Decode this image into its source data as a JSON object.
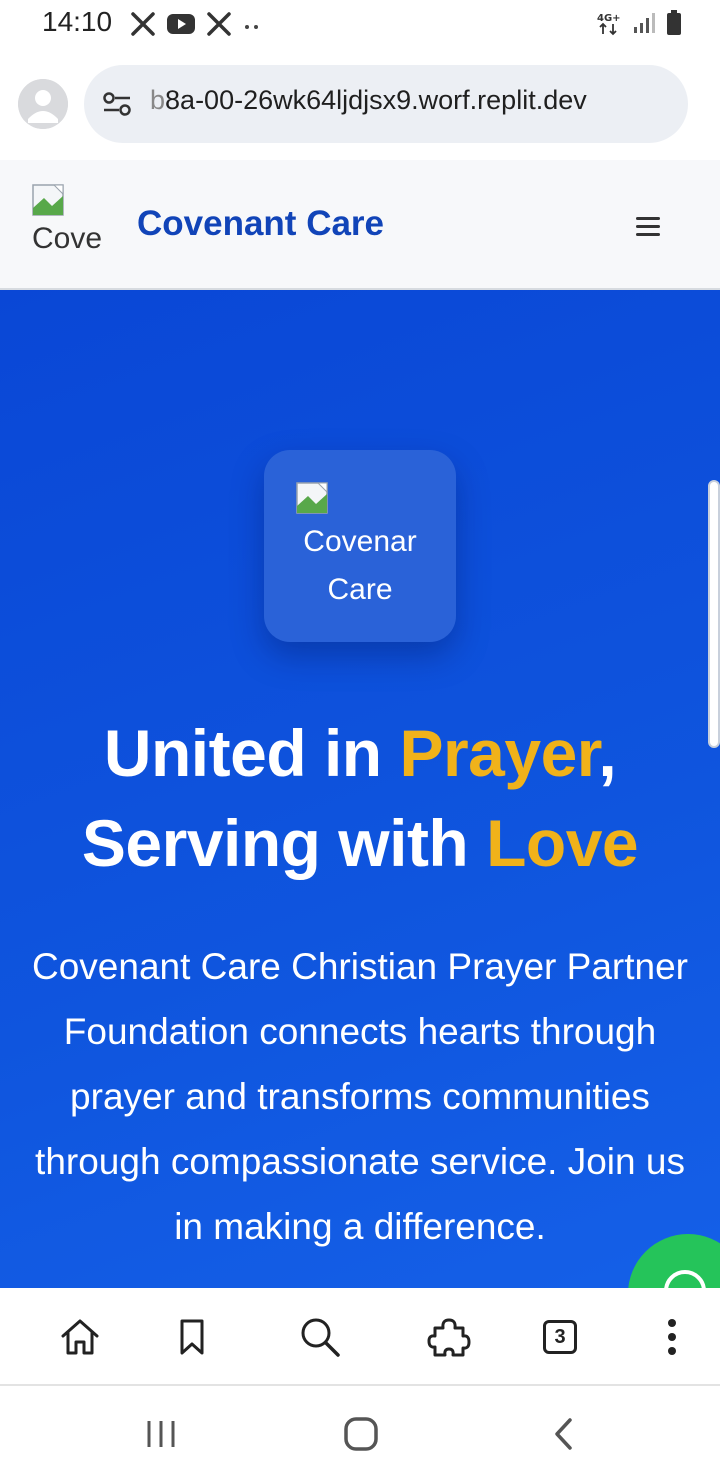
{
  "status_bar": {
    "time": "14:10",
    "notification_icons": [
      "x-logo-icon",
      "youtube-icon",
      "x-logo-icon",
      "more-dots-icon"
    ],
    "network_label": "4G+",
    "system_icons": [
      "signal-icon",
      "battery-icon"
    ]
  },
  "browser": {
    "url_visible": "b8a-00-26wk64ljdjsx9.worf.replit.dev",
    "url_fade_prefix": "b",
    "url_rest": "8a-00-26wk64ljdjsx9.worf.replit.dev",
    "tab_count": "3",
    "toolbar_icons": [
      "home-icon",
      "bookmark-icon",
      "search-icon",
      "extensions-icon",
      "tabs-icon",
      "more-vert-icon"
    ]
  },
  "site": {
    "logo_alt": "Cove",
    "brand": "Covenant Care",
    "menu_icon": "hamburger-icon"
  },
  "hero": {
    "logo_alt_line1": "Covenar",
    "logo_alt_line2": "Care",
    "title_part1": "United in ",
    "title_accent1": "Prayer",
    "title_part2": ",",
    "title_part3": "Serving with ",
    "title_accent2": "Love",
    "description": "Covenant Care Christian Prayer Partner Foundation connects hearts through prayer and transforms communities through compassionate service. Join us in making a difference.",
    "accent_color": "#f0b21a",
    "background_color": "#0a47d6"
  },
  "android_nav": [
    "recents-icon",
    "home-button-icon",
    "back-icon"
  ]
}
